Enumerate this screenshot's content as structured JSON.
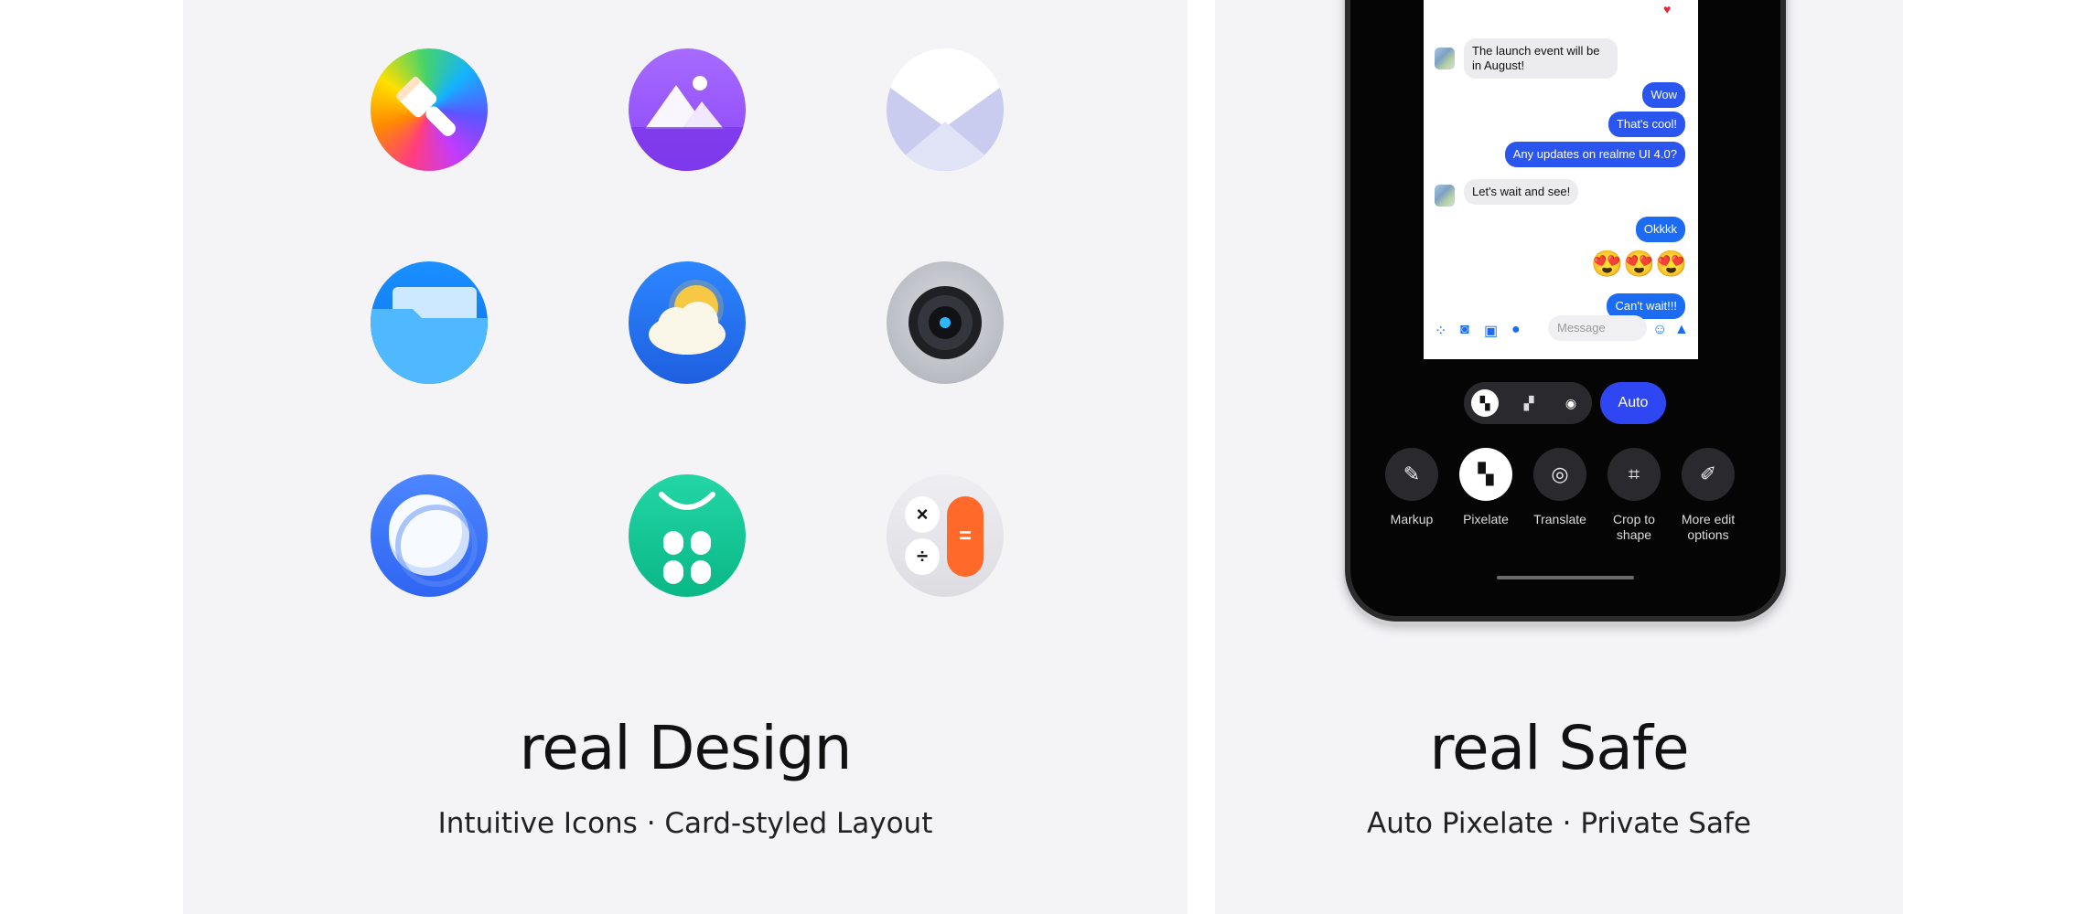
{
  "left_card": {
    "title": "real Design",
    "subtitle": "Intuitive Icons · Card-styled Layout",
    "icons": [
      "theme-store-icon",
      "gallery-icon",
      "mail-icon",
      "files-icon",
      "weather-icon",
      "camera-icon",
      "browser-icon",
      "app-market-icon",
      "calculator-icon"
    ],
    "calculator_symbols": {
      "times": "×",
      "divide": "÷",
      "equals": "="
    }
  },
  "right_card": {
    "title": "real Safe",
    "subtitle": "Auto Pixelate · Private Safe",
    "chat": {
      "messages": [
        {
          "side": "in",
          "text": "The launch event will be in August!"
        },
        {
          "side": "out",
          "text": "Wow"
        },
        {
          "side": "out",
          "text": "That's cool!"
        },
        {
          "side": "out",
          "text": "Any updates on realme UI 4.0?"
        },
        {
          "side": "in",
          "text": "Let's wait and see!"
        },
        {
          "side": "out",
          "text": "Okkkk"
        },
        {
          "side": "out",
          "text": "😍😍😍"
        },
        {
          "side": "out",
          "text": "Can't wait!!!"
        }
      ],
      "heart": "♥",
      "input_placeholder": "Message"
    },
    "mode_button": "Auto",
    "tools": [
      {
        "label": "Markup",
        "icon": "pen-icon",
        "active": false
      },
      {
        "label": "Pixelate",
        "icon": "pixelate-icon",
        "active": true
      },
      {
        "label": "Translate",
        "icon": "translate-icon",
        "active": false
      },
      {
        "label": "Crop to shape",
        "icon": "crop-icon",
        "active": false
      },
      {
        "label": "More edit options",
        "icon": "edit-icon",
        "active": false
      }
    ]
  },
  "colors": {
    "card_bg": "#f4f4f7",
    "accent_blue": "#2f47f3",
    "bubble_blue": "#1b6cf2"
  }
}
